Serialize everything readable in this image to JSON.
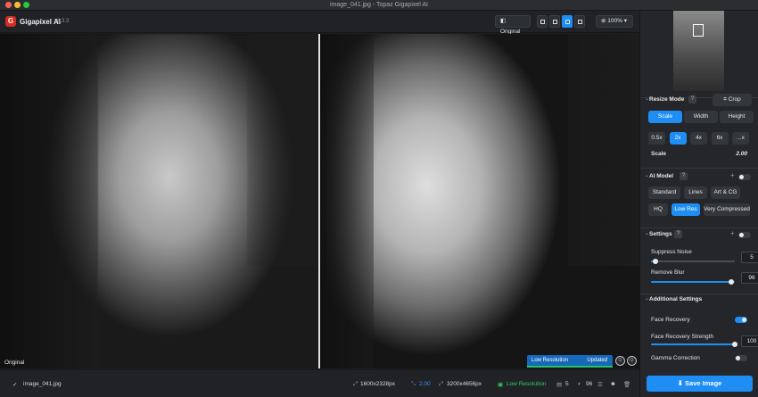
{
  "window": {
    "title": "image_041.jpg - Topaz Gigapixel AI"
  },
  "app": {
    "name": "Gigapixel AI",
    "version": "v6.3.3",
    "logo_letter": "G"
  },
  "toolbar": {
    "original_label": "Original",
    "zoom_label": "100%"
  },
  "canvas": {
    "original_label": "Original",
    "status_low_res": "Low Resolution",
    "status_updated": "Updated",
    "progress": 1.0
  },
  "statusbar": {
    "filename": "image_041.jpg",
    "input_size": "1600x2328px",
    "scale": "2.00",
    "output_size": "3200x4656px",
    "model": "Low Resolution",
    "suppress_noise": "5",
    "remove_blur": "96"
  },
  "panel": {
    "resize": {
      "title": "Resize Mode",
      "crop_label": "Crop",
      "modes": [
        "Scale",
        "Width",
        "Height"
      ],
      "active_mode": "Scale",
      "scales": [
        "0.5x",
        "2x",
        "4x",
        "6x",
        "...x"
      ],
      "active_scale": "2x",
      "scale_label": "Scale",
      "scale_value": "2.00"
    },
    "ai_model": {
      "title": "AI Model",
      "row1": [
        "Standard",
        "Lines",
        "Art & CG"
      ],
      "row2": [
        "HQ",
        "Low Res",
        "Very Compressed"
      ],
      "active": "Low Res"
    },
    "settings": {
      "title": "Settings",
      "suppress_label": "Suppress Noise",
      "suppress_value": "5",
      "suppress_fraction": 0.05,
      "blur_label": "Remove Blur",
      "blur_value": "96",
      "blur_fraction": 0.96
    },
    "additional": {
      "title": "Additional Settings",
      "face_label": "Face Recovery",
      "face_on": true,
      "strength_label": "Face Recovery Strength",
      "strength_value": "100",
      "strength_fraction": 1.0,
      "gamma_label": "Gamma Correction",
      "gamma_on": false
    },
    "save_label": "Save Image"
  }
}
